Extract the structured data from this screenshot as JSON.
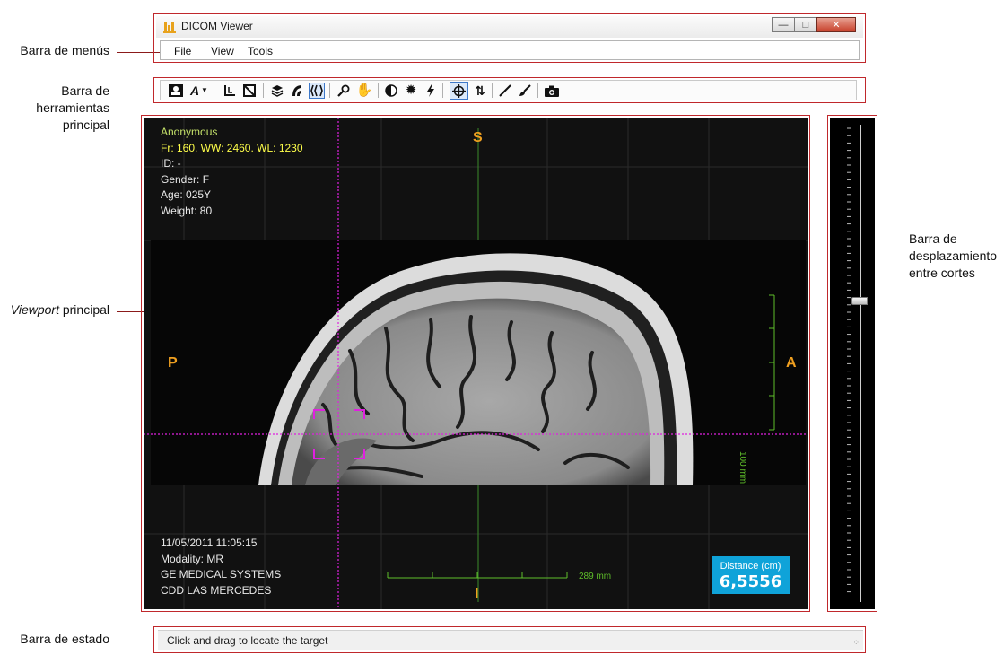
{
  "callouts": {
    "menubar": "Barra de menús",
    "toolbar_1": "Barra de",
    "toolbar_2": "herramientas",
    "toolbar_3": "principal",
    "viewport_italic": "Viewport",
    "viewport_rest": " principal",
    "slicebar_1": "Barra de",
    "slicebar_2": "desplazamiento",
    "slicebar_3": "entre cortes",
    "statusbar": "Barra de estado"
  },
  "window": {
    "title": "DICOM Viewer"
  },
  "menu": [
    "File",
    "View",
    "Tools"
  ],
  "toolbar_icons": [
    "patient-info-icon",
    "font-overlay-icon",
    "dropdown-arrow-icon",
    "measure-icon",
    "window-level-icon",
    "layers-icon",
    "sagittal-icon",
    "stack-icon",
    "zoom-icon",
    "pan-icon",
    "invert-icon",
    "starburst-icon",
    "lightning-icon",
    "crosshair-icon",
    "sync-icon",
    "line-draw-icon",
    "brush-icon",
    "camera-icon"
  ],
  "overlay": {
    "patient_name": "Anonymous",
    "frame_info": "Fr: 160. WW: 2460. WL: 1230",
    "id": "ID: -",
    "gender": "Gender: F",
    "age": "Age: 025Y",
    "weight": "Weight: 80",
    "date": "11/05/2011 11:05:15",
    "modality": "Modality: MR",
    "manufacturer": "GE MEDICAL SYSTEMS",
    "institution": "CDD LAS MERCEDES",
    "orient_top": "S",
    "orient_bottom": "I",
    "orient_left": "P",
    "orient_right": "A",
    "vscale_label": "100 mm",
    "hscale_label": "289 mm",
    "distance_label": "Distance (cm)",
    "distance_value": "6,5556"
  },
  "colors": {
    "accent_frame": "#c0282c",
    "crosshair": "#e020e0",
    "scale": "#5fbf2a",
    "orientation": "#f0a020",
    "distance_box": "#0fa3d9",
    "patient_name": "#c6e36a",
    "frame_info": "#ffff4a"
  },
  "slice_position": 0.37,
  "status": {
    "message": "Click and drag to locate the target"
  }
}
